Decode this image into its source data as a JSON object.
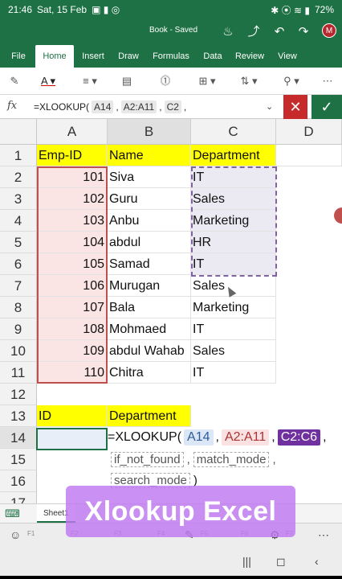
{
  "status": {
    "time": "21:46",
    "date": "Sat, 15 Feb",
    "battery": "72%"
  },
  "title": {
    "doc": "Book - Saved",
    "avatar": "M"
  },
  "ribbon_tabs": [
    "File",
    "Home",
    "Insert",
    "Draw",
    "Formulas",
    "Data",
    "Review",
    "View"
  ],
  "formula_bar": {
    "fx": "fx",
    "text": "=XLOOKUP(",
    "args": [
      "A14",
      "A2:A11",
      "C2"
    ],
    "separator": ","
  },
  "columns": [
    "A",
    "B",
    "C",
    "D"
  ],
  "rows": [
    "1",
    "2",
    "3",
    "4",
    "5",
    "6",
    "7",
    "8",
    "9",
    "10",
    "11",
    "12",
    "13",
    "14",
    "15",
    "16",
    "17"
  ],
  "headers": {
    "id": "Emp-ID",
    "name": "Name",
    "dept": "Department"
  },
  "employees": [
    {
      "id": "101",
      "name": "Siva",
      "dept": "IT"
    },
    {
      "id": "102",
      "name": "Guru",
      "dept": "Sales"
    },
    {
      "id": "103",
      "name": "Anbu",
      "dept": "Marketing"
    },
    {
      "id": "104",
      "name": "abdul",
      "dept": "HR"
    },
    {
      "id": "105",
      "name": "Samad",
      "dept": "IT"
    },
    {
      "id": "106",
      "name": "Murugan",
      "dept": "Sales"
    },
    {
      "id": "107",
      "name": "Bala",
      "dept": "Marketing"
    },
    {
      "id": "108",
      "name": "Mohmaed",
      "dept": "IT"
    },
    {
      "id": "109",
      "name": "abdul Wahab",
      "dept": "Sales"
    },
    {
      "id": "110",
      "name": "Chitra",
      "dept": "IT"
    }
  ],
  "lookup": {
    "id_label": "ID",
    "dept_label": "Department"
  },
  "cell_hint": {
    "text": "=XLOOKUP(",
    "args": [
      "A14",
      "A2:A11",
      "C2:C6"
    ],
    "optional": [
      "if_not_found",
      "match_mode",
      "search_mode"
    ],
    "close": ")"
  },
  "sheet": {
    "name": "Sheet1"
  },
  "fn_keys": [
    "F1",
    "F2",
    "F3",
    "F4",
    "F5",
    "F6",
    "F7"
  ],
  "overlay_title": "Xlookup Excel"
}
